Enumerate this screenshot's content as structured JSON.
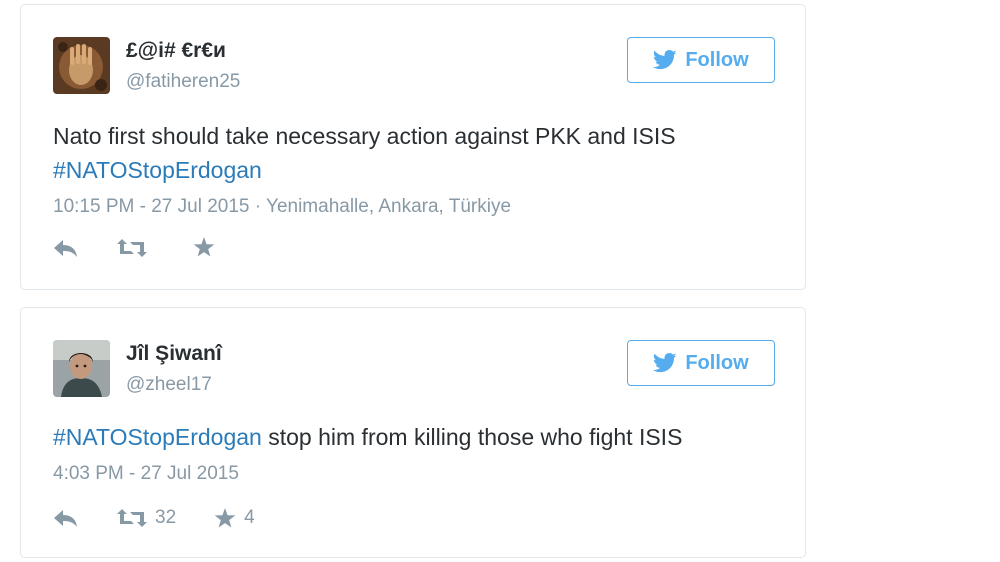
{
  "tweets": [
    {
      "name": "£@i# €r€и",
      "handle": "@fatiheren25",
      "follow_label": "Follow",
      "text": "Nato first should take necessary action against PKK and ISIS",
      "hashtag": "#NATOStopErdogan",
      "timestamp": "10:15 PM - 27 Jul 2015",
      "location": "Yenimahalle, Ankara, Türkiye",
      "retweets": "",
      "favorites": ""
    },
    {
      "name": "Jîl Şiwanî",
      "handle": "@zheel17",
      "follow_label": "Follow",
      "hashtag": "#NATOStopErdogan",
      "text": "stop him from killing those who fight ISIS",
      "timestamp": "4:03 PM - 27 Jul 2015",
      "retweets": "32",
      "favorites": "4"
    }
  ],
  "colors": {
    "accent": "#55acee",
    "hashtag": "#2b7bb9",
    "muted": "#8899a6",
    "text": "#292f33",
    "border": "#e1e8ed"
  },
  "icons": [
    "bird-icon",
    "reply-icon",
    "retweet-icon",
    "favorite-star-icon"
  ]
}
